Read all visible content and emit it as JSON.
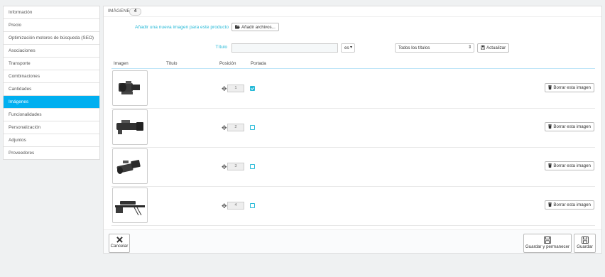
{
  "sidebar": {
    "items": [
      {
        "label": "Información",
        "active": false
      },
      {
        "label": "Precio",
        "active": false
      },
      {
        "label": "Optimización motores de búsqueda (SEO)",
        "active": false
      },
      {
        "label": "Asociaciones",
        "active": false
      },
      {
        "label": "Transporte",
        "active": false
      },
      {
        "label": "Combinaciones",
        "active": false
      },
      {
        "label": "Cantidades",
        "active": false
      },
      {
        "label": "Imágenes",
        "active": true
      },
      {
        "label": "Funcionalidades",
        "active": false
      },
      {
        "label": "Personalización",
        "active": false
      },
      {
        "label": "Adjuntos",
        "active": false
      },
      {
        "label": "Proveedores",
        "active": false
      }
    ]
  },
  "panel": {
    "title": "IMÁGENES",
    "count": "4",
    "add_image_label": "Añadir una nueva imagen para este producto",
    "add_files_button": "Añadir archivos...",
    "title_label": "Título",
    "title_value": "",
    "language": "es",
    "all_titles": "Todos los títulos",
    "update_button": "Actualizar"
  },
  "table": {
    "headers": {
      "image": "Imagen",
      "title": "Título",
      "position": "Posición",
      "cover": "Portada"
    },
    "rows": [
      {
        "position": "1",
        "cover": true,
        "delete_label": "Borrar esta imagen"
      },
      {
        "position": "2",
        "cover": false,
        "delete_label": "Borrar esta imagen"
      },
      {
        "position": "3",
        "cover": false,
        "delete_label": "Borrar esta imagen"
      },
      {
        "position": "4",
        "cover": false,
        "delete_label": "Borrar esta imagen"
      }
    ]
  },
  "footer": {
    "cancel": "Cancelar",
    "save_stay": "Guardar y permanecer",
    "save": "Guardar"
  },
  "colors": {
    "accent": "#25b9d7",
    "active_tab": "#00aff0"
  }
}
